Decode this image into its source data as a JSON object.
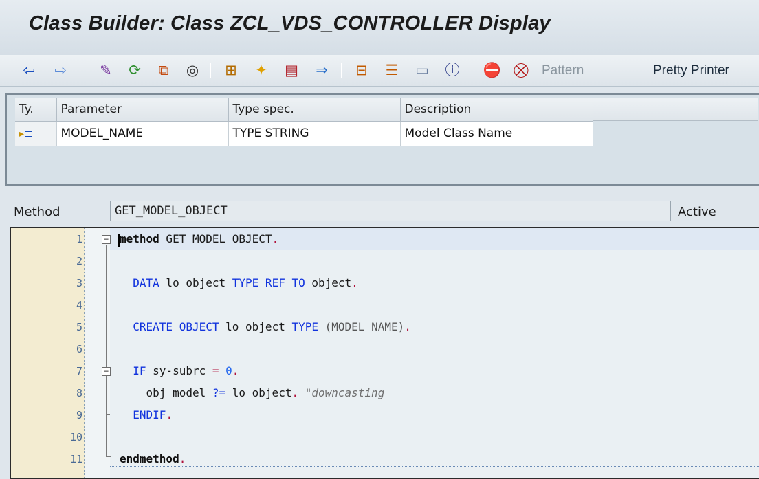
{
  "title": "Class Builder: Class ZCL_VDS_CONTROLLER Display",
  "toolbar": {
    "icons": [
      "back-arrow-icon",
      "forward-arrow-icon",
      "display-change-icon",
      "active-inactive-icon",
      "other-object-icon",
      "where-used-icon",
      "hierarchy-icon",
      "activate-icon",
      "check-icon",
      "navigate-icon",
      "object-list-icon",
      "local-types-icon",
      "window-icon",
      "info-icon",
      "breakpoint-icon",
      "external-breakpoint-icon"
    ],
    "pattern_label": "Pattern",
    "pretty_printer_label": "Pretty Printer"
  },
  "params": {
    "headers": [
      "Ty.",
      "Parameter",
      "Type spec.",
      "Description"
    ],
    "rows": [
      {
        "ty": "importing-icon",
        "parameter": "MODEL_NAME",
        "type_spec": "TYPE STRING",
        "description": "Model Class Name"
      }
    ]
  },
  "method": {
    "label": "Method",
    "name": "GET_MODEL_OBJECT",
    "status": "Active"
  },
  "code": {
    "line_numbers": [
      "1",
      "2",
      "3",
      "4",
      "5",
      "6",
      "7",
      "8",
      "9",
      "10",
      "11"
    ],
    "l1": {
      "kw": "method",
      "rest": " GET_MODEL_OBJECT",
      "dot": "."
    },
    "l3": {
      "kw1": "DATA",
      "t1": " lo_object ",
      "kw2": "TYPE REF TO",
      "t2": " object",
      "dot": "."
    },
    "l5": {
      "kw1": "CREATE OBJECT",
      "t1": " lo_object ",
      "kw2": "TYPE",
      "t2": " (MODEL_NAME)",
      "dot": "."
    },
    "l7": {
      "kw1": "IF",
      "t1": " sy-subrc ",
      "op": "=",
      "num": "0",
      "dot": "."
    },
    "l8": {
      "t1": "obj_model ",
      "op": "?=",
      "t2": " lo_object",
      "dot": ".",
      "cmt": " \"downcasting"
    },
    "l9": {
      "kw": "ENDIF",
      "dot": "."
    },
    "l11": {
      "kw": "endmethod",
      "dot": "."
    }
  },
  "colors": {
    "keyword": "#1133dd",
    "punctuation": "#b0113a",
    "gutter": "#f3ecd1",
    "editor_bg": "#eaf0f3"
  }
}
